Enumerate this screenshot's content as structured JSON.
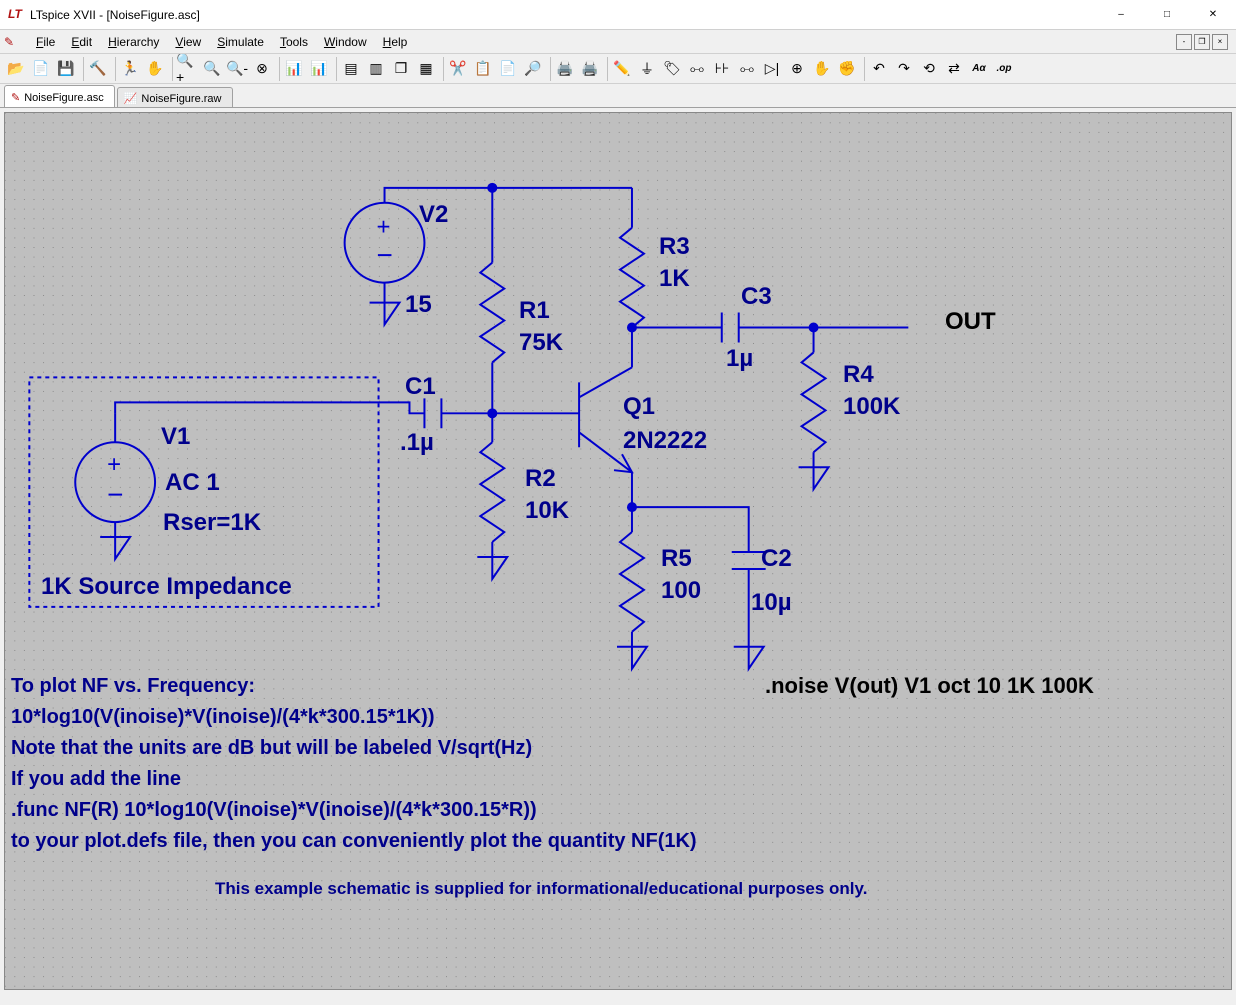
{
  "window": {
    "title": "LTspice XVII - [NoiseFigure.asc]"
  },
  "menus": {
    "file": "File",
    "edit": "Edit",
    "hierarchy": "Hierarchy",
    "view": "View",
    "simulate": "Simulate",
    "tools": "Tools",
    "window": "Window",
    "help": "Help"
  },
  "tabs": {
    "t1": "NoiseFigure.asc",
    "t2": "NoiseFigure.raw"
  },
  "components": {
    "V1": {
      "ref": "V1",
      "val1": "AC 1",
      "val2": "Rser=1K"
    },
    "V2": {
      "ref": "V2",
      "val": "15"
    },
    "C1": {
      "ref": "C1",
      "val": ".1µ"
    },
    "C2": {
      "ref": "C2",
      "val": "10µ"
    },
    "C3": {
      "ref": "C3",
      "val": "1µ"
    },
    "R1": {
      "ref": "R1",
      "val": "75K"
    },
    "R2": {
      "ref": "R2",
      "val": "10K"
    },
    "R3": {
      "ref": "R3",
      "val": "1K"
    },
    "R4": {
      "ref": "R4",
      "val": "100K"
    },
    "R5": {
      "ref": "R5",
      "val": "100"
    },
    "Q1": {
      "ref": "Q1",
      "val": "2N2222"
    },
    "OUT": "OUT"
  },
  "annotations": {
    "src_box": "1K Source Impedance",
    "directive": ".noise V(out) V1 oct 10 1K 100K",
    "notes_title": "To plot NF vs. Frequency:",
    "notes_l1": " 10*log10(V(inoise)*V(inoise)/(4*k*300.15*1K))",
    "notes_l2": " Note that the units are dB but will be labeled V/sqrt(Hz)",
    "notes_l3": " If you add the line",
    "notes_l4": " .func NF(R) 10*log10(V(inoise)*V(inoise)/(4*k*300.15*R))",
    "notes_l5": " to your plot.defs file, then you can conveniently plot the quantity NF(1K)",
    "footer": "This example schematic is supplied for informational/educational purposes only."
  }
}
